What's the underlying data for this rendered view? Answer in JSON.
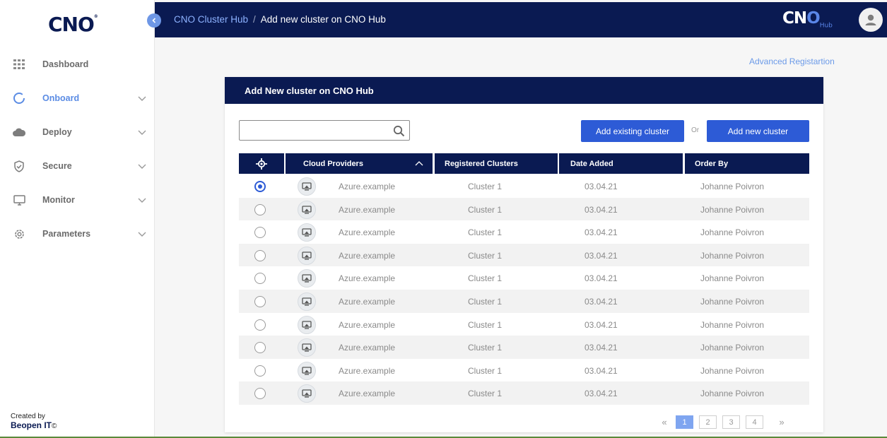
{
  "sidebar": {
    "logo": "CNO",
    "items": [
      {
        "label": "Dashboard",
        "icon": "grid-icon",
        "active": false
      },
      {
        "label": "Onboard",
        "icon": "onboard-ring-icon",
        "active": true
      },
      {
        "label": "Deploy",
        "icon": "cloud-icon",
        "active": false
      },
      {
        "label": "Secure",
        "icon": "shield-icon",
        "active": false
      },
      {
        "label": "Monitor",
        "icon": "monitor-icon",
        "active": false
      },
      {
        "label": "Parameters",
        "icon": "gear-icon",
        "active": false
      }
    ],
    "created_by": "Created by",
    "company": "Beopen IT",
    "copyright": "©"
  },
  "header": {
    "breadcrumb_root": "CNO Cluster Hub",
    "breadcrumb_sep": "/",
    "breadcrumb_current": "Add new cluster on CNO Hub",
    "hub_logo_cn": "CN",
    "hub_logo_o": "O",
    "hub_logo_sub": "Hub"
  },
  "advanced_link": "Advanced Registartion",
  "card": {
    "title": "Add New cluster on CNO Hub",
    "search_value": "",
    "add_existing": "Add existing cluster",
    "or": "Or",
    "add_new": "Add new cluster",
    "columns": {
      "cloud": "Cloud Providers",
      "clusters": "Registered Clusters",
      "date": "Date Added",
      "order": "Order By"
    },
    "rows": [
      {
        "provider": "Azure.example",
        "cluster": "Cluster 1",
        "date": "03.04.21",
        "owner": "Johanne Poivron",
        "selected": true
      },
      {
        "provider": "Azure.example",
        "cluster": "Cluster 1",
        "date": "03.04.21",
        "owner": "Johanne Poivron",
        "selected": false
      },
      {
        "provider": "Azure.example",
        "cluster": "Cluster 1",
        "date": "03.04.21",
        "owner": "Johanne Poivron",
        "selected": false
      },
      {
        "provider": "Azure.example",
        "cluster": "Cluster 1",
        "date": "03.04.21",
        "owner": "Johanne Poivron",
        "selected": false
      },
      {
        "provider": "Azure.example",
        "cluster": "Cluster 1",
        "date": "03.04.21",
        "owner": "Johanne Poivron",
        "selected": false
      },
      {
        "provider": "Azure.example",
        "cluster": "Cluster 1",
        "date": "03.04.21",
        "owner": "Johanne Poivron",
        "selected": false
      },
      {
        "provider": "Azure.example",
        "cluster": "Cluster 1",
        "date": "03.04.21",
        "owner": "Johanne Poivron",
        "selected": false
      },
      {
        "provider": "Azure.example",
        "cluster": "Cluster 1",
        "date": "03.04.21",
        "owner": "Johanne Poivron",
        "selected": false
      },
      {
        "provider": "Azure.example",
        "cluster": "Cluster 1",
        "date": "03.04.21",
        "owner": "Johanne Poivron",
        "selected": false
      },
      {
        "provider": "Azure.example",
        "cluster": "Cluster 1",
        "date": "03.04.21",
        "owner": "Johanne Poivron",
        "selected": false
      }
    ]
  },
  "pagination": {
    "prev": "«",
    "pages": [
      "1",
      "2",
      "3",
      "4"
    ],
    "current": "1",
    "next": "»"
  },
  "colors": {
    "navy": "#0a1a52",
    "primary_blue": "#2d5bd6",
    "active_link": "#5b8ce4"
  }
}
